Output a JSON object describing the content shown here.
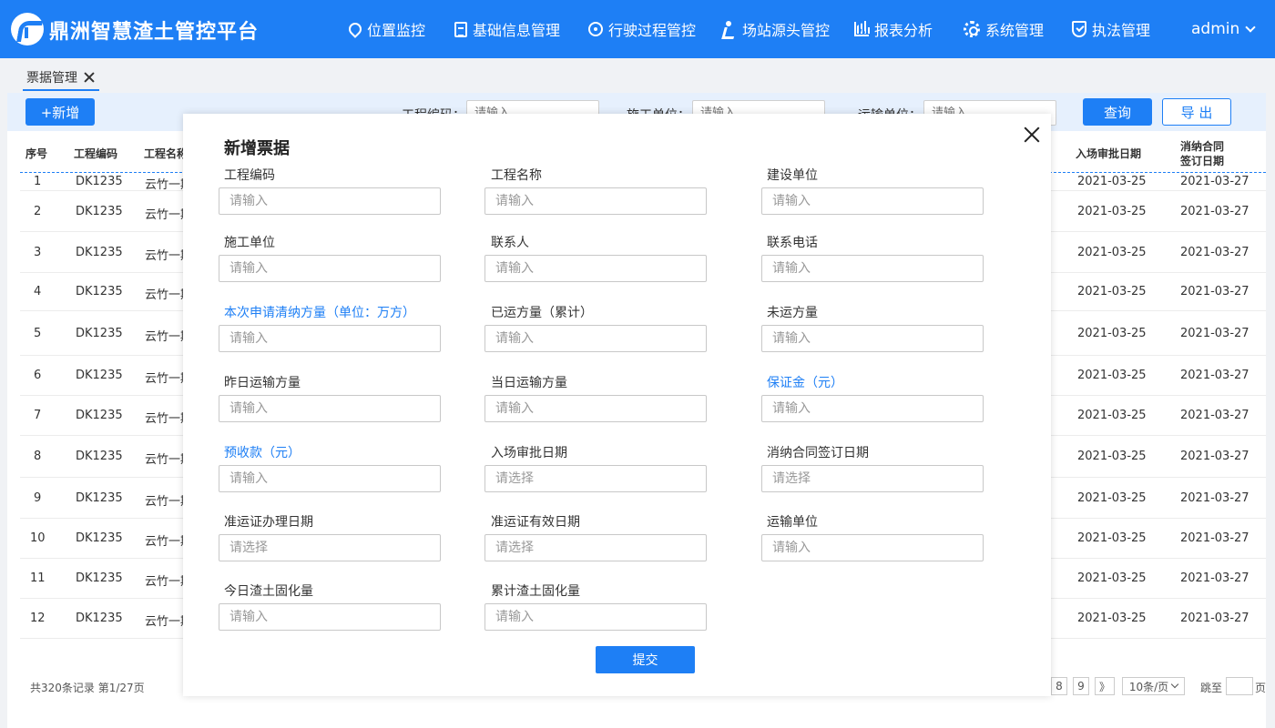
{
  "app": {
    "title": "鼎洲智慧渣土管控平台",
    "user": "admin"
  },
  "nav": [
    {
      "label": "位置监控",
      "icon": "location-pin-icon"
    },
    {
      "label": "基础信息管理",
      "icon": "document-icon"
    },
    {
      "label": "行驶过程管控",
      "icon": "target-icon"
    },
    {
      "label": "场站源头管控",
      "icon": "worker-icon"
    },
    {
      "label": "报表分析",
      "icon": "bar-chart-icon"
    },
    {
      "label": "系统管理",
      "icon": "gear-icon"
    },
    {
      "label": "执法管理",
      "icon": "shield-icon"
    }
  ],
  "tab": {
    "label": "票据管理"
  },
  "toolbar": {
    "add_label": "+新增",
    "query_label": "查询",
    "export_label": "导 出",
    "filters": [
      {
        "label": "工程编码：",
        "placeholder": "请输入"
      },
      {
        "label": "施工单位：",
        "placeholder": "请输入"
      },
      {
        "label": "运输单位：",
        "placeholder": "请输入"
      }
    ]
  },
  "table": {
    "headers": {
      "seq": "序号",
      "code": "工程编码",
      "name": "工程名称",
      "approval": "入场审批日期",
      "contract_line1": "消纳合同",
      "contract_line2": "签订日期"
    },
    "rows": [
      {
        "seq": "1",
        "code": "DK1235",
        "name": "云竹一期",
        "approval": "2021-03-25",
        "contract": "2021-03-27"
      },
      {
        "seq": "2",
        "code": "DK1235",
        "name": "云竹一期",
        "approval": "2021-03-25",
        "contract": "2021-03-27"
      },
      {
        "seq": "3",
        "code": "DK1235",
        "name": "云竹一期",
        "approval": "2021-03-25",
        "contract": "2021-03-27"
      },
      {
        "seq": "4",
        "code": "DK1235",
        "name": "云竹一期",
        "approval": "2021-03-25",
        "contract": "2021-03-27"
      },
      {
        "seq": "5",
        "code": "DK1235",
        "name": "云竹一期",
        "approval": "2021-03-25",
        "contract": "2021-03-27"
      },
      {
        "seq": "6",
        "code": "DK1235",
        "name": "云竹一期",
        "approval": "2021-03-25",
        "contract": "2021-03-27"
      },
      {
        "seq": "7",
        "code": "DK1235",
        "name": "云竹一期",
        "approval": "2021-03-25",
        "contract": "2021-03-27"
      },
      {
        "seq": "8",
        "code": "DK1235",
        "name": "云竹一期",
        "approval": "2021-03-25",
        "contract": "2021-03-27"
      },
      {
        "seq": "9",
        "code": "DK1235",
        "name": "云竹一期",
        "approval": "2021-03-25",
        "contract": "2021-03-27"
      },
      {
        "seq": "10",
        "code": "DK1235",
        "name": "云竹一期",
        "approval": "2021-03-25",
        "contract": "2021-03-27"
      },
      {
        "seq": "11",
        "code": "DK1235",
        "name": "云竹一期",
        "approval": "2021-03-25",
        "contract": "2021-03-27"
      },
      {
        "seq": "12",
        "code": "DK1235",
        "name": "云竹一期",
        "approval": "2021-03-25",
        "contract": "2021-03-27"
      }
    ]
  },
  "pagination": {
    "summary": "共320条记录  第1/27页",
    "page_8": "8",
    "page_9": "9",
    "next": "》",
    "page_size": "10条/页",
    "goto_label": "跳至",
    "page_suffix": "页"
  },
  "modal": {
    "title": "新增票据",
    "submit_label": "提交",
    "fields": [
      {
        "label": "工程编码",
        "placeholder": "请输入",
        "highlight": false
      },
      {
        "label": "工程名称",
        "placeholder": "请输入",
        "highlight": false
      },
      {
        "label": "建设单位",
        "placeholder": "请输入",
        "highlight": false
      },
      {
        "label": "施工单位",
        "placeholder": "请输入",
        "highlight": false
      },
      {
        "label": "联系人",
        "placeholder": "请输入",
        "highlight": false
      },
      {
        "label": "联系电话",
        "placeholder": "请输入",
        "highlight": false
      },
      {
        "label": "本次申请清纳方量（单位：万方）",
        "placeholder": "请输入",
        "highlight": true
      },
      {
        "label": "已运方量（累计）",
        "placeholder": "请输入",
        "highlight": false
      },
      {
        "label": "未运方量",
        "placeholder": "请输入",
        "highlight": false
      },
      {
        "label": "昨日运输方量",
        "placeholder": "请输入",
        "highlight": false
      },
      {
        "label": "当日运输方量",
        "placeholder": "请输入",
        "highlight": false
      },
      {
        "label": "保证金（元）",
        "placeholder": "请输入",
        "highlight": true
      },
      {
        "label": "预收款（元）",
        "placeholder": "请输入",
        "highlight": true
      },
      {
        "label": "入场审批日期",
        "placeholder": "请选择",
        "highlight": false
      },
      {
        "label": "消纳合同签订日期",
        "placeholder": "请选择",
        "highlight": false
      },
      {
        "label": "准运证办理日期",
        "placeholder": "请选择",
        "highlight": false
      },
      {
        "label": "准运证有效日期",
        "placeholder": "请选择",
        "highlight": false
      },
      {
        "label": "运输单位",
        "placeholder": "请输入",
        "highlight": false
      },
      {
        "label": "今日渣土固化量",
        "placeholder": "请输入",
        "highlight": false
      },
      {
        "label": "累计渣土固化量",
        "placeholder": "请输入",
        "highlight": false
      }
    ]
  },
  "colors": {
    "primary": "#1e7ff5",
    "toolbar_bg": "#e6f0fd"
  }
}
